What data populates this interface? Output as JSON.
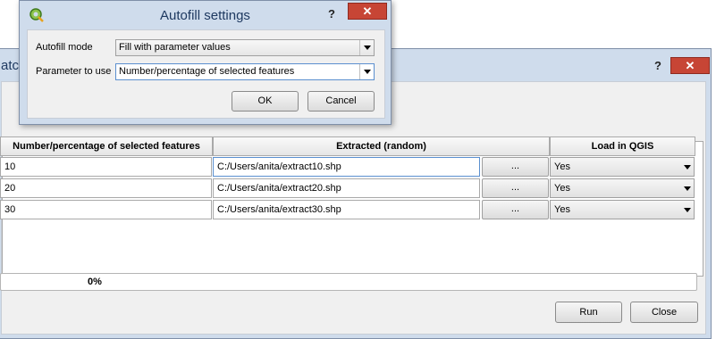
{
  "batch_window": {
    "title_fragment": "atc",
    "help_glyph": "?",
    "close_glyph": "✕",
    "columns": [
      "Number/percentage of selected features",
      "Extracted (random)",
      "Load in QGIS"
    ],
    "rows": [
      {
        "number": "10",
        "extracted": "C:/Users/anita/extract10.shp",
        "browse": "...",
        "load": "Yes"
      },
      {
        "number": "20",
        "extracted": "C:/Users/anita/extract20.shp",
        "browse": "...",
        "load": "Yes"
      },
      {
        "number": "30",
        "extracted": "C:/Users/anita/extract30.shp",
        "browse": "...",
        "load": "Yes"
      }
    ],
    "progress": {
      "value": 0,
      "text": "0%"
    },
    "run_label": "Run",
    "close_label": "Close"
  },
  "dialog": {
    "title": "Autofill settings",
    "help_glyph": "?",
    "close_glyph": "✕",
    "autofill_mode_label": "Autofill mode",
    "autofill_mode_value": "Fill with parameter values",
    "parameter_label": "Parameter to use",
    "parameter_value": "Number/percentage of selected features",
    "ok_label": "OK",
    "cancel_label": "Cancel"
  },
  "colors": {
    "title_bar": "#cfdcec",
    "close_button": "#c74535",
    "focus_border": "#5b8fcf"
  },
  "icons": [
    "qgis-logo-icon",
    "help-icon",
    "close-icon",
    "dropdown-arrow-icon"
  ]
}
